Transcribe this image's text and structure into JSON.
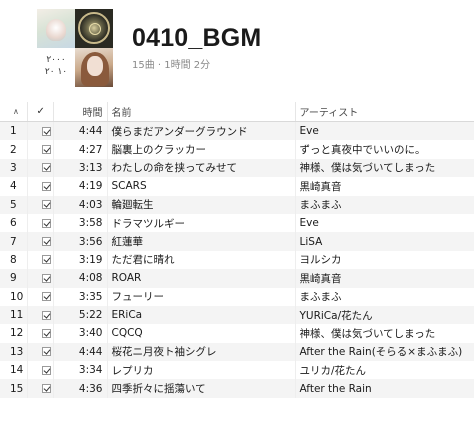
{
  "playlist": {
    "title": "0410_BGM",
    "meta": "15曲 · 1時間 2分",
    "artwork_text": "٢٠٠٠\n١٠ ٢٠"
  },
  "columns": {
    "sort_indicator": "∧",
    "check": "✓",
    "time": "時間",
    "name": "名前",
    "artist": "アーティスト"
  },
  "tracks": [
    {
      "num": "1",
      "time": "4:44",
      "name": "僕らまだアンダーグラウンド",
      "artist": "Eve"
    },
    {
      "num": "2",
      "time": "4:27",
      "name": "脳裏上のクラッカー",
      "artist": "ずっと真夜中でいいのに。"
    },
    {
      "num": "3",
      "time": "3:13",
      "name": "わたしの命を挟ってみせて",
      "artist": "神様、僕は気づいてしまった"
    },
    {
      "num": "4",
      "time": "4:19",
      "name": "SCARS",
      "artist": "黒崎真音"
    },
    {
      "num": "5",
      "time": "4:03",
      "name": "輪廻転生",
      "artist": "まふまふ"
    },
    {
      "num": "6",
      "time": "3:58",
      "name": "ドラマツルギー",
      "artist": "Eve"
    },
    {
      "num": "7",
      "time": "3:56",
      "name": "紅蓮華",
      "artist": "LiSA"
    },
    {
      "num": "8",
      "time": "3:19",
      "name": "ただ君に晴れ",
      "artist": "ヨルシカ"
    },
    {
      "num": "9",
      "time": "4:08",
      "name": "ROAR",
      "artist": "黒崎真音"
    },
    {
      "num": "10",
      "time": "3:35",
      "name": "フューリー",
      "artist": "まふまふ"
    },
    {
      "num": "11",
      "time": "5:22",
      "name": "ERiCa",
      "artist": "YURiCa/花たん"
    },
    {
      "num": "12",
      "time": "3:40",
      "name": "CQCQ",
      "artist": "神様、僕は気づいてしまった"
    },
    {
      "num": "13",
      "time": "4:44",
      "name": "桜花ニ月夜ト袖シグレ",
      "artist": "After the Rain(そらる×まふまふ)"
    },
    {
      "num": "14",
      "time": "3:34",
      "name": "レプリカ",
      "artist": "ユリカ/花たん"
    },
    {
      "num": "15",
      "time": "4:36",
      "name": "四季折々に揺蕩いて",
      "artist": "After the Rain"
    }
  ]
}
